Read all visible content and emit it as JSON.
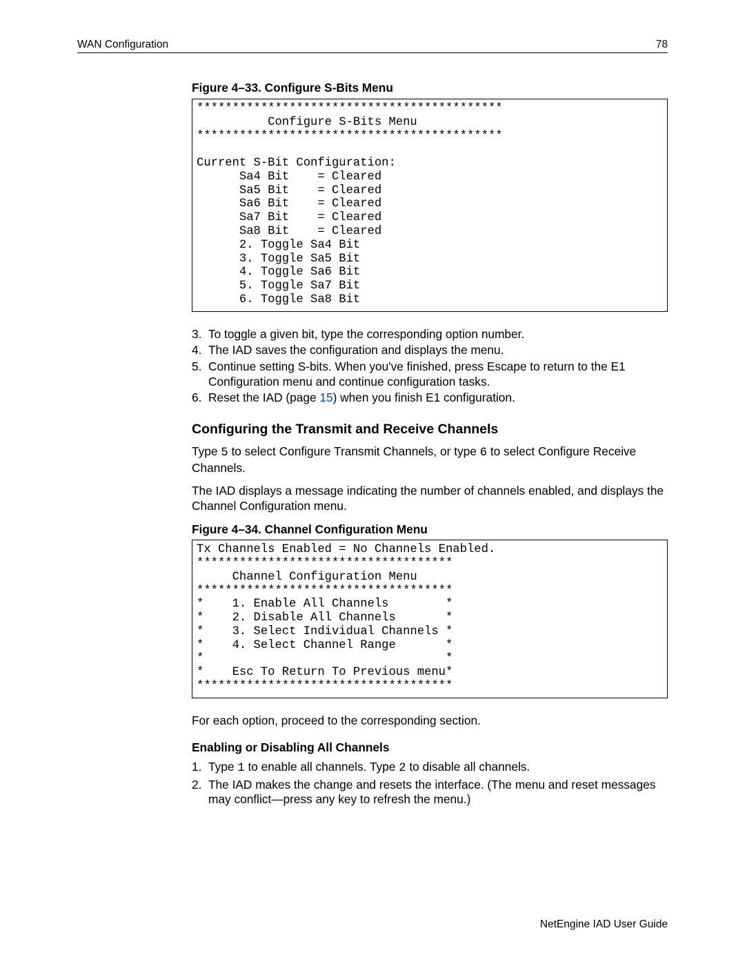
{
  "header": {
    "left": "WAN Configuration",
    "right": "78"
  },
  "fig33": {
    "caption": "Figure 4–33.  Configure S-Bits Menu",
    "lines": [
      "*******************************************",
      "          Configure S-Bits Menu",
      "*******************************************",
      "",
      "Current S-Bit Configuration:",
      "      Sa4 Bit    = Cleared",
      "      Sa5 Bit    = Cleared",
      "      Sa6 Bit    = Cleared",
      "      Sa7 Bit    = Cleared",
      "      Sa8 Bit    = Cleared",
      "      2. Toggle Sa4 Bit",
      "      3. Toggle Sa5 Bit",
      "      4. Toggle Sa6 Bit",
      "      5. Toggle Sa7 Bit",
      "      6. Toggle Sa8 Bit"
    ]
  },
  "steps1": [
    {
      "n": "3.",
      "parts": [
        {
          "t": "To toggle a given bit, type the corresponding option number."
        }
      ]
    },
    {
      "n": "4.",
      "parts": [
        {
          "t": "The IAD saves the configuration and displays the menu."
        }
      ]
    },
    {
      "n": "5.",
      "parts": [
        {
          "t": "Continue setting S-bits. When you've finished, press Escape to return to the E1 Configuration menu and continue configuration tasks."
        }
      ]
    },
    {
      "n": "6.",
      "parts": [
        {
          "t": "Reset the IAD (page "
        },
        {
          "t": "15",
          "link": true
        },
        {
          "t": ") when you finish E1 configuration."
        }
      ]
    }
  ],
  "section2": {
    "heading": "Configuring the Transmit and Receive Channels",
    "p1_parts": [
      {
        "t": "Type "
      },
      {
        "t": "5",
        "mono": true
      },
      {
        "t": " to select Configure Transmit Channels, or type "
      },
      {
        "t": "6",
        "mono": true
      },
      {
        "t": "  to select Configure Receive Channels."
      }
    ],
    "p2": "The IAD displays a message indicating the number of channels enabled, and displays the Channel Configuration menu."
  },
  "fig34": {
    "caption": "Figure 4–34.  Channel Configuration Menu",
    "lines": [
      "Tx Channels Enabled = No Channels Enabled.",
      "************************************",
      "     Channel Configuration Menu",
      "************************************",
      "*    1. Enable All Channels        *",
      "*    2. Disable All Channels       *",
      "*    3. Select Individual Channels *",
      "*    4. Select Channel Range       *",
      "*                                  *",
      "*    Esc To Return To Previous menu*",
      "************************************"
    ]
  },
  "p_after_fig34": "For each option, proceed to the corresponding section.",
  "subsection": {
    "heading": "Enabling or Disabling All Channels",
    "steps": [
      {
        "n": "1.",
        "parts": [
          {
            "t": "Type "
          },
          {
            "t": "1",
            "mono": true
          },
          {
            "t": " to enable all channels. Type "
          },
          {
            "t": "2",
            "mono": true
          },
          {
            "t": " to disable all channels."
          }
        ]
      },
      {
        "n": "2.",
        "parts": [
          {
            "t": "The IAD makes the change and resets the interface. (The menu and reset messages may conflict—press any key to refresh the menu.)"
          }
        ]
      }
    ]
  },
  "footer": "NetEngine IAD User Guide"
}
